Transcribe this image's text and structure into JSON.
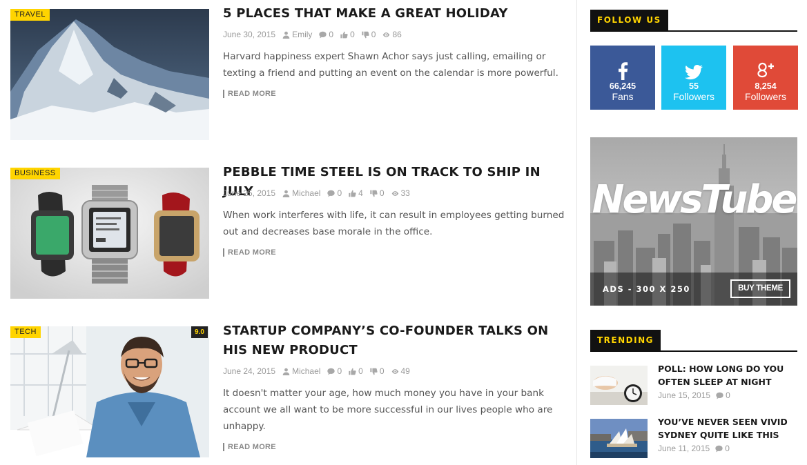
{
  "posts": [
    {
      "category": "TRAVEL",
      "title": "5 PLACES THAT MAKE A GREAT HOLIDAY",
      "date": "June 30, 2015",
      "author": "Emily",
      "comments": "0",
      "likes": "0",
      "dislikes": "0",
      "views": "86",
      "excerpt": "Harvard happiness expert Shawn Achor says just calling, emailing or texting a friend and putting an event on the calendar is more powerful.",
      "read_more": "READ MORE"
    },
    {
      "category": "BUSINESS",
      "title": "PEBBLE TIME STEEL IS ON TRACK TO SHIP IN JULY",
      "date": "June 25, 2015",
      "author": "Michael",
      "comments": "0",
      "likes": "4",
      "dislikes": "0",
      "views": "33",
      "excerpt": "When work interferes with life, it can result in employees getting burned out and decreases base morale in the office.",
      "read_more": "READ MORE"
    },
    {
      "category": "TECH",
      "score": "9.0",
      "title": "STARTUP COMPANY’S CO-FOUNDER TALKS ON HIS NEW PRODUCT",
      "date": "June 24, 2015",
      "author": "Michael",
      "comments": "0",
      "likes": "0",
      "dislikes": "0",
      "views": "49",
      "excerpt": "It doesn't matter your age, how much money you have in your bank account we all want to be more successful in our lives people who are unhappy.",
      "read_more": "READ MORE"
    }
  ],
  "sidebar": {
    "follow_title": "FOLLOW US",
    "social": [
      {
        "network": "facebook",
        "icon": "facebook-icon",
        "count": "66,245",
        "label": "Fans",
        "color": "#3b5998"
      },
      {
        "network": "twitter",
        "icon": "twitter-icon",
        "count": "55",
        "label": "Followers",
        "color": "#1dc2f0"
      },
      {
        "network": "google-plus",
        "icon": "google-plus-icon",
        "count": "8,254",
        "label": "Followers",
        "color": "#e04a38"
      }
    ],
    "ad": {
      "logo": "NewsTube",
      "label": "ADS - 300 X 250",
      "button": "BUY THEME"
    },
    "trending_title": "TRENDING",
    "trending": [
      {
        "title": "POLL: HOW LONG DO YOU OFTEN SLEEP AT NIGHT",
        "date": "June 15, 2015",
        "comments": "0"
      },
      {
        "title": "YOU’VE NEVER SEEN VIVID SYDNEY QUITE LIKE THIS",
        "date": "June 11, 2015",
        "comments": "0"
      }
    ]
  },
  "colors": {
    "accent": "#ffd400",
    "dark": "#111111",
    "meta_text": "#999999"
  }
}
